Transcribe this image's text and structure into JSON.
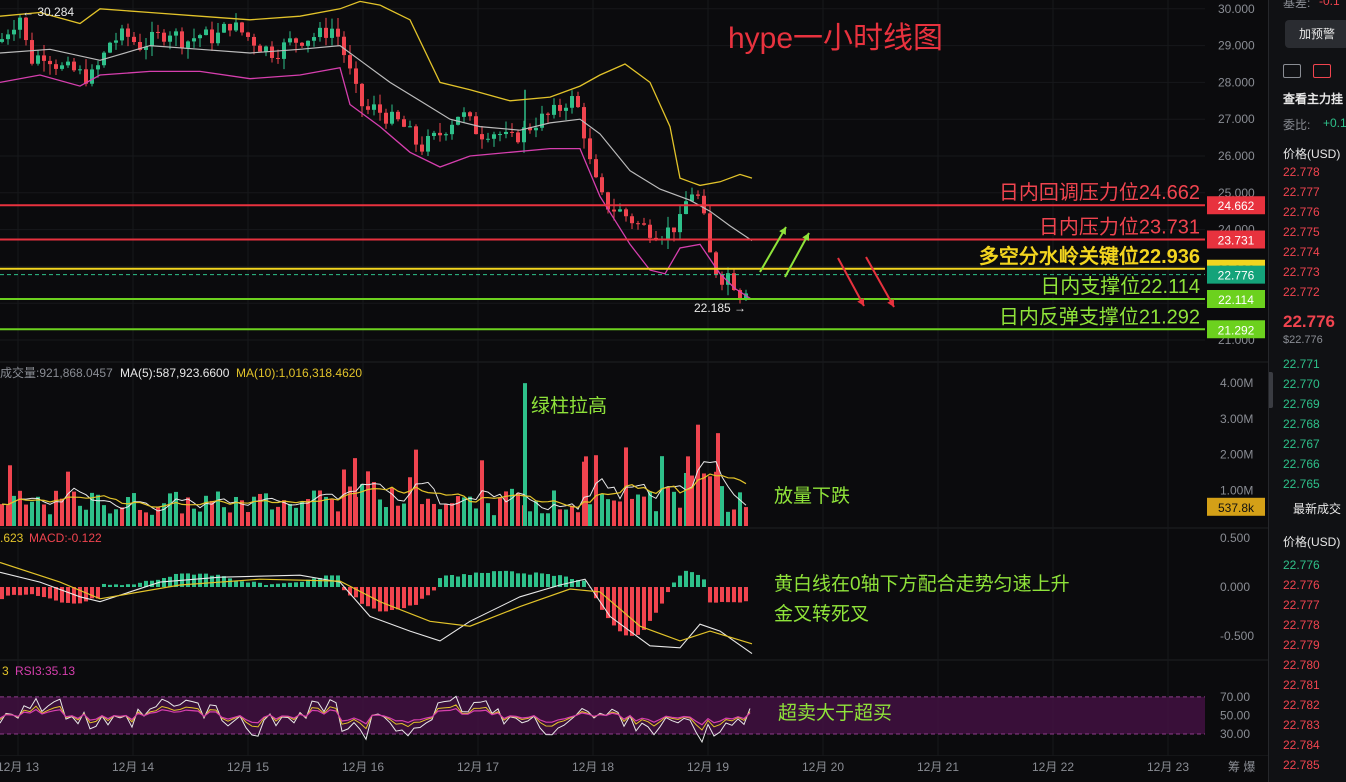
{
  "chart_data": [
    {
      "type": "candlestick",
      "title": "hype一小时线图",
      "indicators": [
        "Bollinger Bands"
      ],
      "ylim": [
        21.0,
        30.5
      ],
      "y_ticks": [
        "30.000",
        "29.000",
        "28.000",
        "27.000",
        "26.000",
        "25.000",
        "24.000",
        "23.000",
        "22.000",
        "21.000"
      ],
      "x_ticks": [
        "12月 13",
        "12月 14",
        "12月 15",
        "12月 16",
        "12月 17",
        "12月 18",
        "12月 19",
        "12月 20",
        "12月 21",
        "12月 22",
        "12月 23"
      ],
      "x_axis_end_label": "筹 爆",
      "price_path": [
        [
          0,
          29.1
        ],
        [
          10,
          29.5
        ],
        [
          20,
          29.8
        ],
        [
          30,
          28.6
        ],
        [
          45,
          28.8
        ],
        [
          60,
          28.4
        ],
        [
          75,
          28.3
        ],
        [
          90,
          28.1
        ],
        [
          100,
          28.5
        ],
        [
          110,
          29.1
        ],
        [
          125,
          29.3
        ],
        [
          140,
          29.0
        ],
        [
          155,
          29.2
        ],
        [
          170,
          29.4
        ],
        [
          185,
          29.1
        ],
        [
          200,
          29.3
        ],
        [
          215,
          29.2
        ],
        [
          230,
          29.6
        ],
        [
          245,
          29.3
        ],
        [
          260,
          29.0
        ],
        [
          275,
          28.8
        ],
        [
          290,
          29.1
        ],
        [
          305,
          29.2
        ],
        [
          320,
          29.3
        ],
        [
          335,
          29.5
        ],
        [
          345,
          28.7
        ],
        [
          355,
          27.8
        ],
        [
          365,
          27.2
        ],
        [
          375,
          27.3
        ],
        [
          390,
          27.0
        ],
        [
          400,
          26.9
        ],
        [
          410,
          26.6
        ],
        [
          420,
          26.2
        ],
        [
          430,
          26.4
        ],
        [
          440,
          26.6
        ],
        [
          450,
          26.9
        ],
        [
          460,
          27.2
        ],
        [
          470,
          26.9
        ],
        [
          480,
          26.6
        ],
        [
          490,
          26.7
        ],
        [
          500,
          26.6
        ],
        [
          510,
          26.4
        ],
        [
          520,
          26.6
        ],
        [
          530,
          26.8
        ],
        [
          540,
          27.0
        ],
        [
          550,
          27.1
        ],
        [
          560,
          27.3
        ],
        [
          570,
          27.6
        ],
        [
          580,
          27.2
        ],
        [
          590,
          25.8
        ],
        [
          600,
          24.9
        ],
        [
          610,
          24.6
        ],
        [
          620,
          24.5
        ],
        [
          630,
          24.3
        ],
        [
          640,
          24.1
        ],
        [
          650,
          24.0
        ],
        [
          660,
          23.9
        ],
        [
          670,
          24.0
        ],
        [
          680,
          24.2
        ],
        [
          690,
          25.1
        ],
        [
          700,
          24.8
        ],
        [
          705,
          24.1
        ],
        [
          710,
          23.3
        ],
        [
          716,
          22.9
        ],
        [
          722,
          22.7
        ],
        [
          728,
          22.8
        ],
        [
          735,
          22.5
        ],
        [
          740,
          22.25
        ],
        [
          745,
          22.4
        ],
        [
          750,
          22.6
        ],
        [
          753,
          22.776
        ]
      ],
      "bb_upper_path": [
        [
          0,
          29.8
        ],
        [
          40,
          29.9
        ],
        [
          80,
          29.6
        ],
        [
          100,
          30.0
        ],
        [
          150,
          29.9
        ],
        [
          200,
          29.8
        ],
        [
          250,
          29.7
        ],
        [
          300,
          29.8
        ],
        [
          340,
          30.0
        ],
        [
          360,
          30.2
        ],
        [
          380,
          30.1
        ],
        [
          410,
          29.7
        ],
        [
          440,
          28.0
        ],
        [
          470,
          27.8
        ],
        [
          510,
          27.5
        ],
        [
          550,
          27.6
        ],
        [
          580,
          27.9
        ],
        [
          600,
          28.2
        ],
        [
          625,
          28.5
        ],
        [
          650,
          28.0
        ],
        [
          670,
          26.8
        ],
        [
          680,
          25.4
        ],
        [
          690,
          25.3
        ],
        [
          700,
          25.2
        ],
        [
          720,
          25.3
        ],
        [
          740,
          25.5
        ],
        [
          752,
          25.4
        ]
      ],
      "bb_middle_path": [
        [
          0,
          28.8
        ],
        [
          50,
          28.9
        ],
        [
          100,
          28.6
        ],
        [
          150,
          29.0
        ],
        [
          200,
          28.9
        ],
        [
          250,
          28.8
        ],
        [
          300,
          28.9
        ],
        [
          340,
          29.0
        ],
        [
          360,
          28.6
        ],
        [
          390,
          28.0
        ],
        [
          420,
          27.5
        ],
        [
          450,
          27.0
        ],
        [
          480,
          26.8
        ],
        [
          520,
          26.7
        ],
        [
          550,
          26.9
        ],
        [
          580,
          27.0
        ],
        [
          600,
          26.6
        ],
        [
          630,
          25.6
        ],
        [
          660,
          25.1
        ],
        [
          690,
          24.8
        ],
        [
          710,
          24.5
        ],
        [
          730,
          24.1
        ],
        [
          752,
          23.7
        ]
      ],
      "bb_lower_path": [
        [
          0,
          28.0
        ],
        [
          40,
          28.2
        ],
        [
          80,
          27.9
        ],
        [
          100,
          28.2
        ],
        [
          150,
          28.3
        ],
        [
          200,
          28.3
        ],
        [
          250,
          28.1
        ],
        [
          300,
          28.2
        ],
        [
          340,
          28.4
        ],
        [
          350,
          27.4
        ],
        [
          380,
          26.8
        ],
        [
          410,
          26.1
        ],
        [
          440,
          25.7
        ],
        [
          470,
          26.0
        ],
        [
          510,
          26.1
        ],
        [
          550,
          26.2
        ],
        [
          580,
          26.2
        ],
        [
          600,
          24.9
        ],
        [
          630,
          23.6
        ],
        [
          650,
          22.9
        ],
        [
          665,
          22.8
        ],
        [
          680,
          23.5
        ],
        [
          700,
          23.6
        ],
        [
          720,
          22.8
        ],
        [
          735,
          22.4
        ],
        [
          752,
          22.1
        ]
      ],
      "annotations": {
        "high_label": "30.284",
        "low_label": "22.185",
        "current_price": "22.776",
        "current_price_hidden_tag": "22.936",
        "levels": [
          {
            "price": 24.662,
            "text": "日内回调压力位24.662",
            "tag": "24.662",
            "color": "#e8323e",
            "text_color": "#f0444f"
          },
          {
            "price": 23.731,
            "text": "日内压力位23.731",
            "tag": "23.731",
            "color": "#e8323e",
            "text_color": "#f0444f"
          },
          {
            "price": 22.936,
            "text": "多空分水岭关键位22.936",
            "tag": "22.936",
            "color": "#f2d51f",
            "text_color": "#f2d51f"
          },
          {
            "price": 22.114,
            "text": "日内支撑位22.114",
            "tag": "22.114",
            "color": "#6cd11e",
            "text_color": "#8fe33a"
          },
          {
            "price": 21.292,
            "text": "日内反弹支撑位21.292",
            "tag": "21.292",
            "color": "#6cd11e",
            "text_color": "#8fe33a"
          }
        ]
      }
    },
    {
      "type": "bar",
      "title": "成交量",
      "header_value": "921,868.0457",
      "ma5_label": "MA(5):587,923.6600",
      "ma10_label": "MA(10):1,016,318.4620",
      "ylim": [
        0,
        4200000
      ],
      "y_ticks": [
        "4.00M",
        "3.00M",
        "2.00M",
        "1.00M"
      ],
      "current_tag": "537.8k",
      "annotations": [
        "绿柱拉高",
        "放量下跌"
      ]
    },
    {
      "type": "bar",
      "title": "MACD",
      "header_left": ".623",
      "header_label": "MACD:-0.122",
      "ylim": [
        -0.75,
        0.6
      ],
      "y_ticks": [
        "0.500",
        "0.000",
        "-0.500"
      ],
      "annotations": [
        "黄白线在0轴下方配合走势匀速上升",
        "金叉转死叉"
      ]
    },
    {
      "type": "line",
      "title": "RSI",
      "header_left": "3",
      "header_label": "RSI3:35.13",
      "ylim": [
        15,
        82
      ],
      "y_ticks": [
        "70.00",
        "50.00",
        "30.00"
      ],
      "annotations": [
        "超卖大于超买"
      ]
    }
  ],
  "sidebar": {
    "top_left": "基差:",
    "top_right": "-0.1",
    "alert_button": "加预警",
    "section_title": "查看主力挂",
    "ratio_label": "委比:",
    "ratio_value": "+0.1",
    "price_header": "价格(USD)",
    "asks": [
      "22.778",
      "22.777",
      "22.776",
      "22.775",
      "22.774",
      "22.773",
      "22.772"
    ],
    "last_price": "22.776",
    "last_price_usd": "$22.776",
    "bids": [
      "22.771",
      "22.770",
      "22.769",
      "22.768",
      "22.767",
      "22.766",
      "22.765"
    ],
    "trades_title": "最新成交",
    "trades_header": "价格(USD)",
    "trades": [
      {
        "p": "22.776",
        "c": "green"
      },
      {
        "p": "22.776",
        "c": "red"
      },
      {
        "p": "22.777",
        "c": "red"
      },
      {
        "p": "22.778",
        "c": "red"
      },
      {
        "p": "22.779",
        "c": "red"
      },
      {
        "p": "22.780",
        "c": "red"
      },
      {
        "p": "22.781",
        "c": "red"
      },
      {
        "p": "22.782",
        "c": "red"
      },
      {
        "p": "22.783",
        "c": "red"
      },
      {
        "p": "22.784",
        "c": "red"
      },
      {
        "p": "22.785",
        "c": "red"
      }
    ]
  },
  "colors": {
    "up": "#2ec08a",
    "down": "#f0444f",
    "bb_upper": "#e2c32a",
    "bb_middle": "#bcbcbc",
    "bb_lower": "#d63fae",
    "ma5": "#e8e8e8",
    "ma10": "#e2c32a",
    "rsi_band": "#4a1248"
  }
}
